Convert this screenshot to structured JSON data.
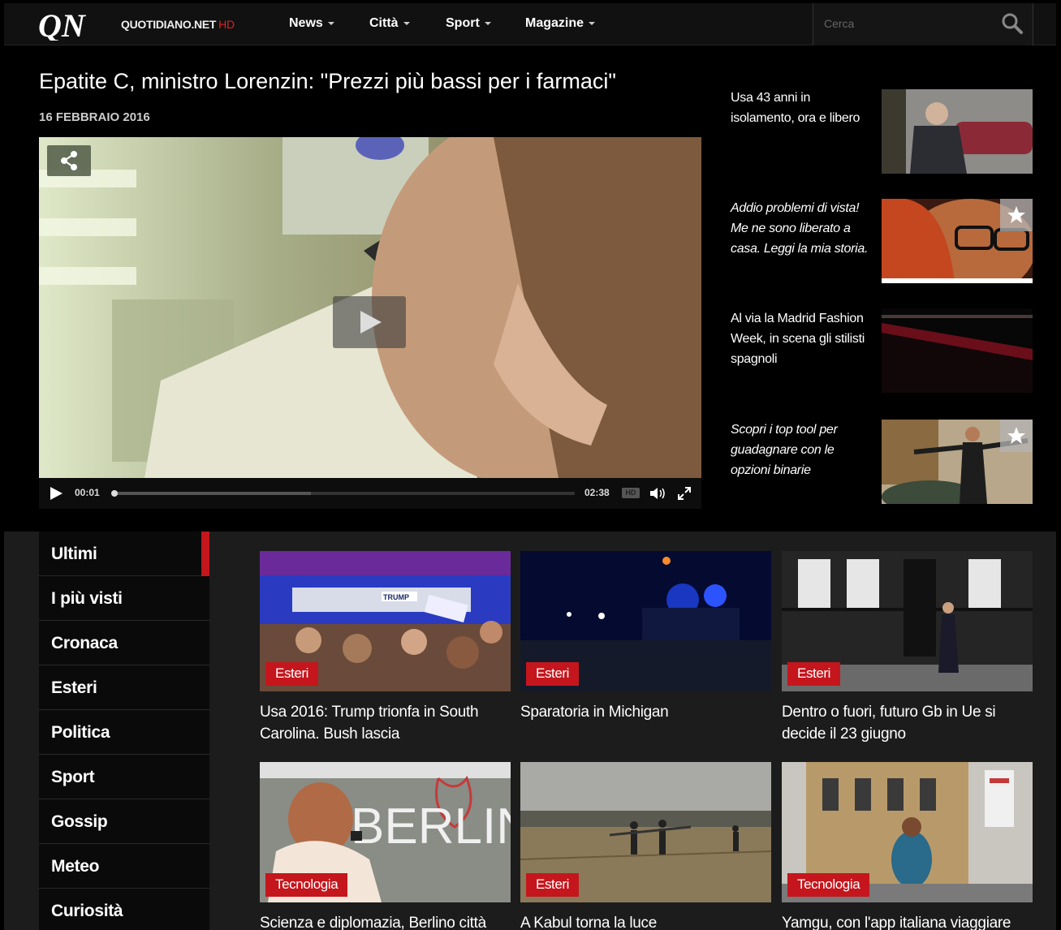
{
  "brand": {
    "logo": "QN",
    "name": "QUOTIDIANO.NET",
    "suffix": "HD"
  },
  "nav": {
    "items": [
      {
        "label": "News"
      },
      {
        "label": "Città"
      },
      {
        "label": "Sport"
      },
      {
        "label": "Magazine"
      }
    ]
  },
  "search": {
    "placeholder": "Cerca"
  },
  "hero": {
    "title": "Epatite C, ministro Lorenzin: \"Prezzi più bassi per i farmaci\"",
    "date": "16 FEBBRAIO 2016",
    "player": {
      "current_time": "00:01",
      "duration": "02:38",
      "hd_label": "HD",
      "progress": 0.002,
      "buffered": 0.43
    }
  },
  "side": {
    "items": [
      {
        "text": "Usa 43 anni in isolamento, ora e libero",
        "sponsored": false
      },
      {
        "text": "Addio problemi di vista! Me ne sono liberato a casa. Leggi la mia storia.",
        "sponsored": true
      },
      {
        "text": "Al via la Madrid Fashion Week, in scena gli stilisti spagnoli",
        "sponsored": false
      },
      {
        "text": "Scopri i top tool per guadagnare con le opzioni binarie",
        "sponsored": true
      }
    ]
  },
  "categories": {
    "items": [
      {
        "label": "Ultimi",
        "active": true
      },
      {
        "label": "I più visti"
      },
      {
        "label": "Cronaca"
      },
      {
        "label": "Esteri"
      },
      {
        "label": "Politica"
      },
      {
        "label": "Sport"
      },
      {
        "label": "Gossip"
      },
      {
        "label": "Meteo"
      },
      {
        "label": "Curiosità"
      }
    ]
  },
  "cards": {
    "items": [
      {
        "tag": "Esteri",
        "title": "Usa 2016: Trump trionfa in South Carolina. Bush lascia",
        "thumb_text": "TRUMP"
      },
      {
        "tag": "Esteri",
        "title": "Sparatoria in Michigan"
      },
      {
        "tag": "Esteri",
        "title": "Dentro o fuori, futuro Gb in Ue si decide il 23 giugno"
      },
      {
        "tag": "Tecnologia",
        "title": "Scienza e diplomazia, Berlino città",
        "thumb_text": "BERLIN"
      },
      {
        "tag": "Esteri",
        "title": "A Kabul torna la luce"
      },
      {
        "tag": "Tecnologia",
        "title": "Yamgu, con l'app italiana viaggiare"
      }
    ]
  },
  "colors": {
    "accent": "#c4161c",
    "background": "#000000",
    "panel": "#1c1c1c"
  }
}
